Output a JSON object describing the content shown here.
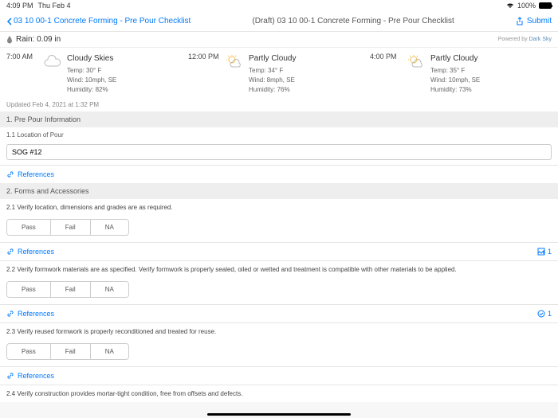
{
  "status": {
    "time": "4:09 PM",
    "date": "Thu Feb 4",
    "battery": "100%"
  },
  "nav": {
    "back": "03 10 00-1 Concrete Forming - Pre Pour Checklist",
    "title": "(Draft) 03 10 00-1 Concrete Forming - Pre Pour Checklist",
    "submit": "Submit"
  },
  "rain": {
    "label": "Rain: 0.09 in",
    "powered": "Powered by ",
    "darksky": "Dark Sky"
  },
  "weather": [
    {
      "time": "7:00 AM",
      "cond": "Cloudy Skies",
      "temp": "Temp: 30° F",
      "wind": "Wind: 10mph, SE",
      "hum": "Humidity: 82%"
    },
    {
      "time": "12:00 PM",
      "cond": "Partly Cloudy",
      "temp": "Temp: 34° F",
      "wind": "Wind: 8mph, SE",
      "hum": "Humidity: 76%"
    },
    {
      "time": "4:00 PM",
      "cond": "Partly Cloudy",
      "temp": "Temp: 35° F",
      "wind": "Wind: 10mph, SE",
      "hum": "Humidity: 73%"
    }
  ],
  "updated": "Updated Feb 4, 2021 at 1:32 PM",
  "sections": {
    "s1": "1. Pre Pour Information",
    "s1_1": "1.1 Location of Pour",
    "input_val": "SOG #12",
    "ref": "References",
    "s2": "2. Forms and Accessories",
    "q21": "2.1 Verify location, dimensions and grades are as required.",
    "q22": "2.2 Verify formwork materials are as specified. Verify formwork is properly sealed, oiled or wetted and treatment is compatible with other materials to be applied.",
    "q23": "2.3 Verify reused formwork is properly reconditioned and treated for reuse.",
    "q24": "2.4 Verify construction provides mortar-tight condition, free from offsets and defects.",
    "count": "1"
  },
  "seg": {
    "pass": "Pass",
    "fail": "Fail",
    "na": "NA"
  }
}
